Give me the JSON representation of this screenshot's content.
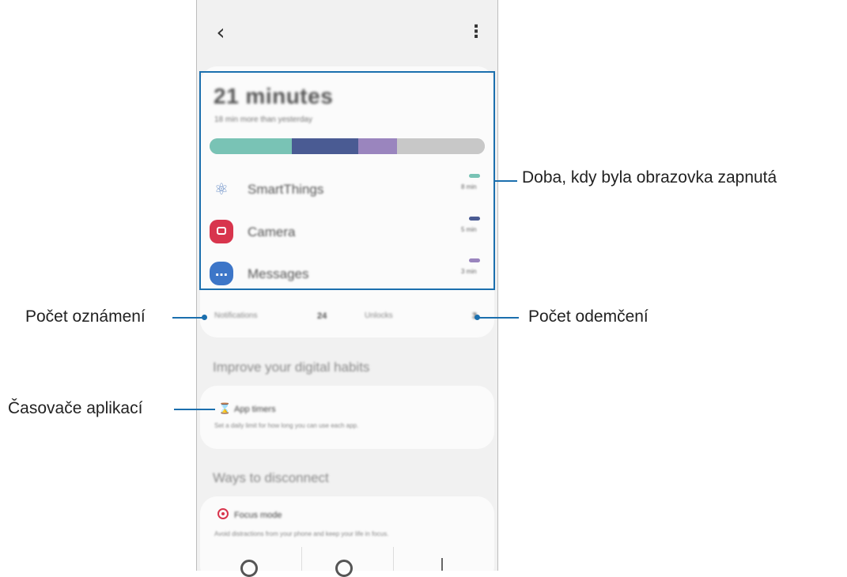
{
  "screen": {
    "usage_total": "21 minutes",
    "usage_compare": "18 min more than yesterday",
    "usage_bar": {
      "segments": [
        {
          "app": "SmartThings",
          "color": "#79c3b5",
          "fraction": 0.3
        },
        {
          "app": "Camera",
          "color": "#4a5b93",
          "fraction": 0.24
        },
        {
          "app": "Messages",
          "color": "#9a85be",
          "fraction": 0.14
        },
        {
          "app": "Other",
          "color": "#c8c8c8",
          "fraction": 0.32
        }
      ]
    },
    "apps": [
      {
        "name": "SmartThings",
        "time": "8 min",
        "icon": "smartthings-icon",
        "legend_color": "#79c3b5"
      },
      {
        "name": "Camera",
        "time": "5 min",
        "icon": "camera-icon",
        "legend_color": "#4a5b93"
      },
      {
        "name": "Messages",
        "time": "3 min",
        "icon": "messages-icon",
        "legend_color": "#9a85be"
      }
    ],
    "stats": {
      "notifications_label": "Notifications",
      "notifications_value": "24",
      "unlocks_label": "Unlocks",
      "unlocks_value": "3"
    },
    "improve_heading": "Improve your digital habits",
    "app_timers": {
      "title": "App timers",
      "description": "Set a daily limit for how long you can use each app."
    },
    "disconnect_heading": "Ways to disconnect",
    "focus_mode": {
      "title": "Focus mode",
      "description": "Avoid distractions from your phone and keep your life in focus."
    }
  },
  "callouts": {
    "screen_time": "Doba, kdy byla obrazovka zapnutá",
    "notifications": "Počet oznámení",
    "unlocks": "Počet odemčení",
    "app_timers": "Časovače aplikací"
  },
  "colors": {
    "callout_line": "#1b6fae"
  }
}
